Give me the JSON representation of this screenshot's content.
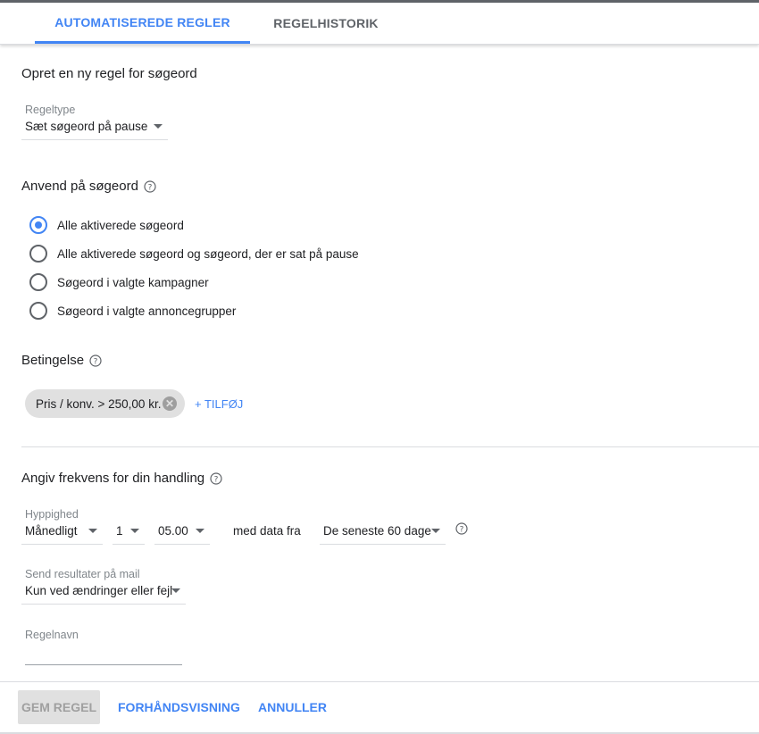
{
  "tabs": [
    {
      "label": "AUTOMATISEREDE REGLER",
      "active": true
    },
    {
      "label": "REGELHISTORIK",
      "active": false
    }
  ],
  "form": {
    "title": "Opret en ny regel for søgeord",
    "rule_type": {
      "label": "Regeltype",
      "value": "Sæt søgeord på pause"
    },
    "apply_to": {
      "title": "Anvend på søgeord",
      "options": [
        {
          "label": "Alle aktiverede søgeord",
          "checked": true
        },
        {
          "label": "Alle aktiverede søgeord og søgeord, der er sat på pause",
          "checked": false
        },
        {
          "label": "Søgeord i valgte kampagner",
          "checked": false
        },
        {
          "label": "Søgeord i valgte annoncegrupper",
          "checked": false
        }
      ]
    },
    "condition": {
      "title": "Betingelse",
      "chip": "Pris / konv. > 250,00 kr.",
      "add_label": "+ TILFØJ"
    },
    "frequency": {
      "title": "Angiv frekvens for din handling",
      "label": "Hyppighed",
      "period": "Månedligt",
      "day": "1",
      "time": "05.00",
      "data_from_text": "med data fra",
      "range": "De seneste 60 dage"
    },
    "email": {
      "label": "Send resultater på mail",
      "value": "Kun ved ændringer eller fejl"
    },
    "rule_name": {
      "label": "Regelnavn",
      "value": ""
    }
  },
  "footer": {
    "save_label": "GEM REGEL",
    "preview_label": "FORHÅNDSVISNING",
    "cancel_label": "ANNULLER"
  },
  "colors": {
    "accent": "#4285f4",
    "disabled_bg": "#e0e0e0"
  },
  "icons": {
    "help": "help-circle-icon",
    "dropdown": "caret-down-icon",
    "chip_remove": "close-circle-icon"
  }
}
